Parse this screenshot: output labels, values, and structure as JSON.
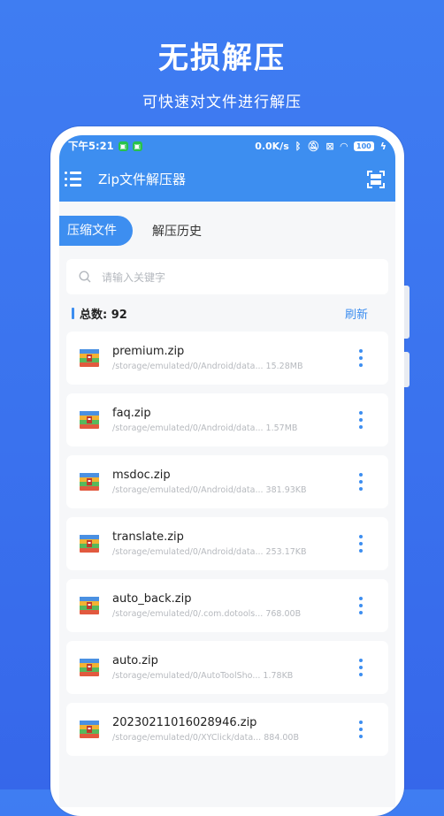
{
  "promo": {
    "title": "无损解压",
    "subtitle": "可快速对文件进行解压"
  },
  "status_bar": {
    "time": "下午5:21",
    "speed": "0.0K/s",
    "battery": "100"
  },
  "app_bar": {
    "title": "Zip文件解压器"
  },
  "tabs": [
    {
      "label": "压缩文件"
    },
    {
      "label": "解压历史"
    }
  ],
  "search": {
    "placeholder": "请输入关键字"
  },
  "summary": {
    "count_text": "总数: 92",
    "refresh_label": "刷新"
  },
  "files": [
    {
      "name": "premium.zip",
      "path": "/storage/emulated/0/Android/data...",
      "size": "15.28MB"
    },
    {
      "name": "faq.zip",
      "path": "/storage/emulated/0/Android/data...",
      "size": "1.57MB"
    },
    {
      "name": "msdoc.zip",
      "path": "/storage/emulated/0/Android/data...",
      "size": "381.93KB"
    },
    {
      "name": "translate.zip",
      "path": "/storage/emulated/0/Android/data...",
      "size": "253.17KB"
    },
    {
      "name": "auto_back.zip",
      "path": "/storage/emulated/0/.com.dotools...",
      "size": "768.00B"
    },
    {
      "name": "auto.zip",
      "path": "/storage/emulated/0/AutoToolSho...",
      "size": "1.78KB"
    },
    {
      "name": "20230211016028946.zip",
      "path": "/storage/emulated/0/XYClick/data...",
      "size": "884.00B"
    }
  ],
  "colors": {
    "accent": "#3d8ef0",
    "background": "#3f7df2"
  },
  "icons": {
    "menu": "menu-icon",
    "scan": "scan-icon",
    "search": "search-icon",
    "file": "zip-archive-icon",
    "more": "more-vertical-icon"
  }
}
